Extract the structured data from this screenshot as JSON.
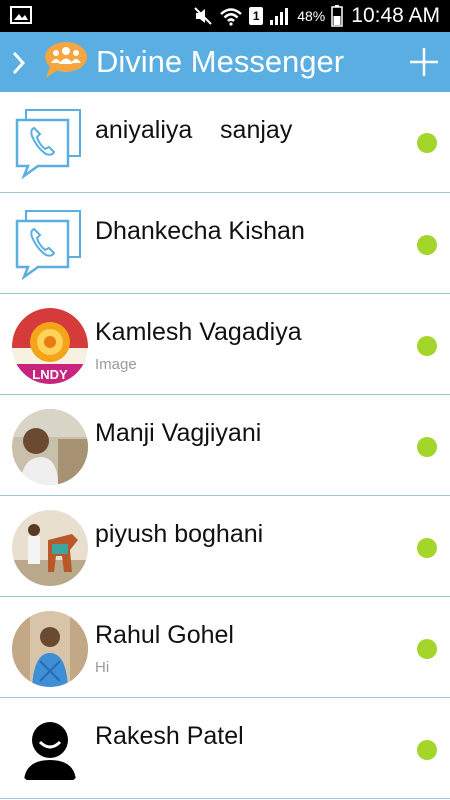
{
  "status_bar": {
    "battery_percent": "48%",
    "time": "10:48 AM",
    "sim_label": "1",
    "icons": [
      "image-icon",
      "mute-icon",
      "wifi-icon",
      "sim-icon",
      "signal-icon",
      "battery-icon"
    ]
  },
  "app_bar": {
    "title": "Divine Messenger",
    "color": "#5aaee1",
    "icons": [
      "chevron-right-icon",
      "group-chat-logo-icon",
      "plus-icon"
    ]
  },
  "contacts": [
    {
      "name": "aniyaliya    sanjay",
      "preview": "",
      "avatar": "phone-chat-icon",
      "online": true
    },
    {
      "name": "Dhankecha Kishan",
      "preview": "",
      "avatar": "phone-chat-icon",
      "online": true
    },
    {
      "name": "Kamlesh Vagadiya",
      "preview": "Image",
      "avatar": "sun-logo-photo",
      "online": true
    },
    {
      "name": "Manji Vagjiyani",
      "preview": "",
      "avatar": "person-photo",
      "online": true
    },
    {
      "name": "piyush boghani",
      "preview": "",
      "avatar": "horse-photo",
      "online": true
    },
    {
      "name": "Rahul Gohel",
      "preview": "Hi",
      "avatar": "person-photo",
      "online": true
    },
    {
      "name": "Rakesh Patel",
      "preview": "",
      "avatar": "default-user-icon",
      "online": true
    }
  ],
  "colors": {
    "online": "#a4d52a",
    "divider": "#9fc4d6"
  }
}
